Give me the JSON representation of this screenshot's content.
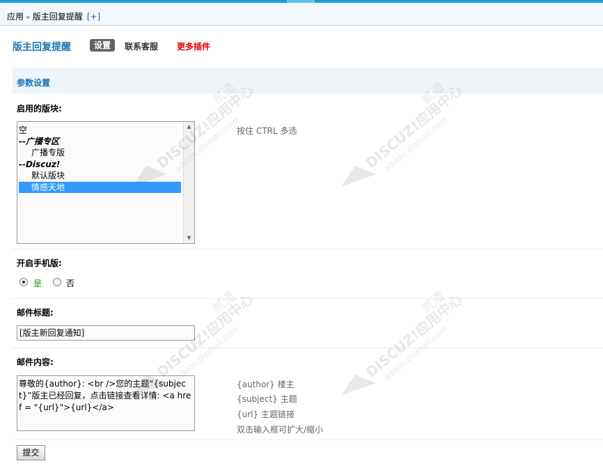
{
  "breadcrumb": {
    "apps": "应用",
    "separator": "»",
    "current": "版主回复提醒",
    "add": "[+]"
  },
  "header": {
    "plugin_title": "版主回复提醒",
    "tab_settings": "设置",
    "tab_contact": "联系客服",
    "tab_more": "更多插件"
  },
  "section": {
    "title": "参数设置"
  },
  "forums": {
    "label": "启用的版块:",
    "tip": "按住 CTRL 多选",
    "options": [
      "空",
      "--广播专区",
      "广播专版",
      "--Discuz!",
      "默认版块",
      "情感天地"
    ],
    "selected": "情感天地"
  },
  "mobile": {
    "label": "开启手机版:",
    "yes": "是",
    "no": "否",
    "value": "是"
  },
  "mail_subject": {
    "label": "邮件标题:",
    "value": "[版主新回复通知]"
  },
  "mail_content": {
    "label": "邮件内容:",
    "value": "尊敬的{author}: <br />您的主题“{subject}”版主已经回复，点击链接查看详情: <a href = \"{url}\">{url}</a>",
    "help": [
      {
        "code": "{author}",
        "desc": "楼主"
      },
      {
        "code": "{subject}",
        "desc": "主题"
      },
      {
        "code": "{url}",
        "desc": "主题链接"
      }
    ],
    "resize_tip": "双击输入框可扩大/缩小"
  },
  "submit_label": "提交",
  "watermark": {
    "brand": "DISCUZ!应用中心",
    "domain": "addon.dismall.com",
    "mark": "贰道"
  },
  "colors": {
    "accent": "#1d75b8",
    "more_plugins": "#e60000",
    "radio_yes": "#009900",
    "selection": "#3399ff"
  }
}
